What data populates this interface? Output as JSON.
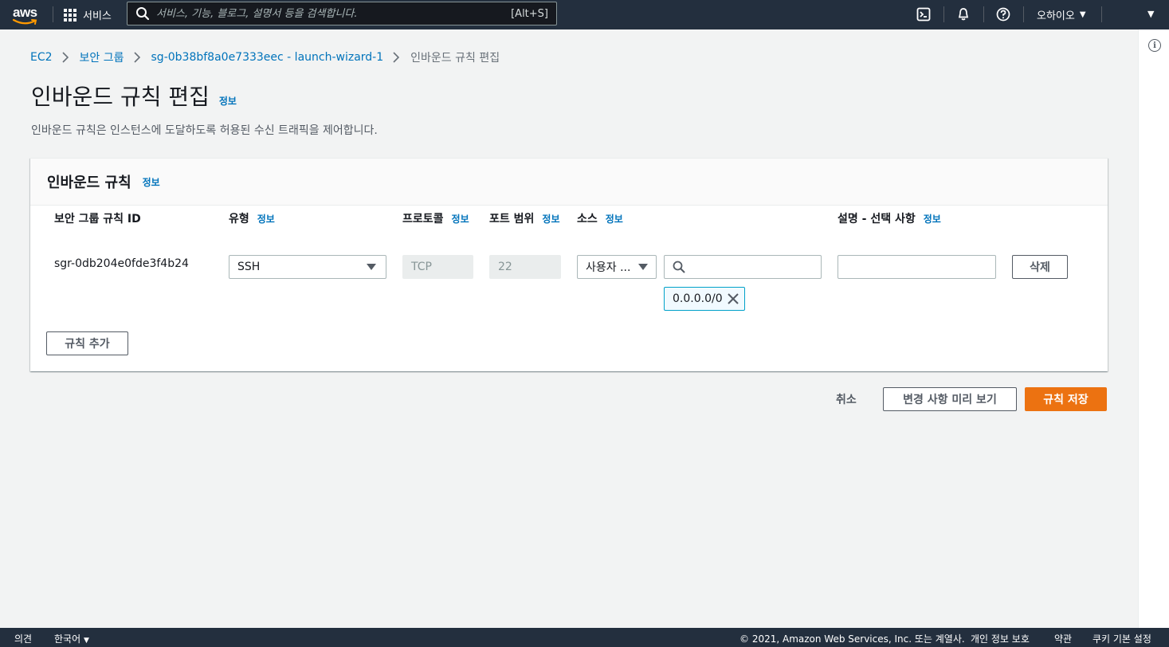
{
  "topnav": {
    "logo": "aws",
    "services_label": "서비스",
    "search_placeholder": "서비스, 기능, 블로그, 설명서 등을 검색합니다.",
    "search_shortcut": "[Alt+S]",
    "region_label": "오하이오",
    "icons": [
      "cloudshell-icon",
      "bell-icon",
      "help-icon"
    ]
  },
  "breadcrumb": {
    "items": [
      "EC2",
      "보안 그룹",
      "sg-0b38bf8a0e7333eec - launch-wizard-1"
    ],
    "current": "인바운드 규칙 편집"
  },
  "page": {
    "title": "인바운드 규칙 편집",
    "info": "정보",
    "description": "인바운드 규칙은 인스턴스에 도달하도록 허용된 수신 트래픽을 제어합니다."
  },
  "panel": {
    "title": "인바운드 규칙",
    "info": "정보",
    "columns": {
      "rule_id": "보안 그룹 규칙 ID",
      "type": "유형",
      "protocol": "프로토콜",
      "port_range": "포트 범위",
      "source": "소스",
      "description": "설명 - 선택 사항",
      "info": "정보"
    },
    "rule": {
      "id": "sgr-0db204e0fde3f4b24",
      "type": "SSH",
      "protocol": "TCP",
      "port": "22",
      "source_type": "사용자 ...",
      "source_search": "",
      "source_token": "0.0.0.0/0",
      "description": "",
      "delete_label": "삭제"
    },
    "add_rule_label": "규칙 추가"
  },
  "actions": {
    "cancel": "취소",
    "preview": "변경 사항 미리 보기",
    "save": "규칙 저장"
  },
  "footer": {
    "feedback": "의견",
    "language": "한국어",
    "copyright": "© 2021, Amazon Web Services, Inc. 또는 계열사.",
    "privacy": "개인 정보 보호",
    "terms": "약관",
    "cookies": "쿠키 기본 설정"
  },
  "colors": {
    "nav_bg": "#232f3e",
    "link": "#0073bb",
    "primary": "#ec7211",
    "token_border": "#00a1c9"
  }
}
